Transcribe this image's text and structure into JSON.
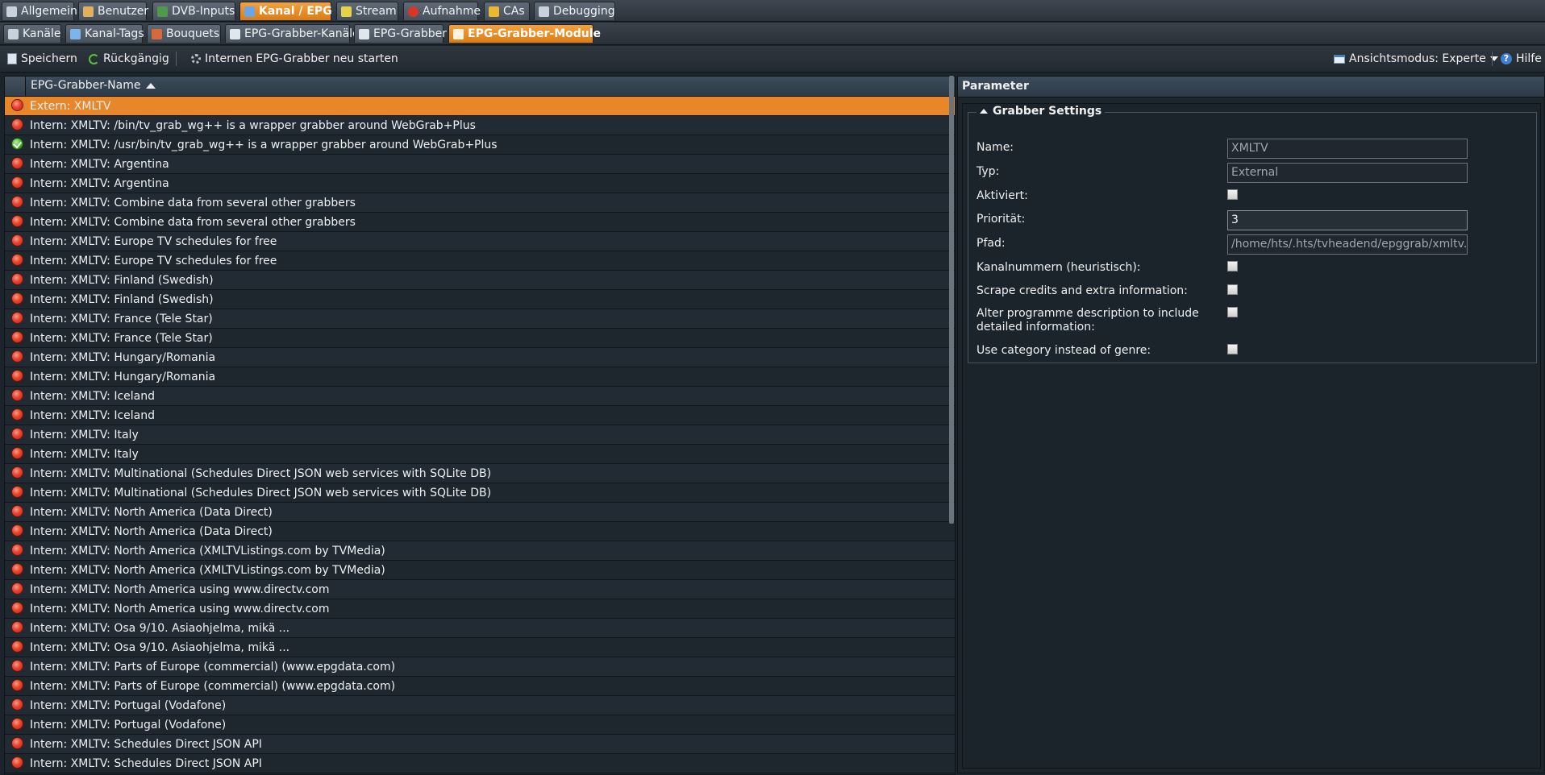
{
  "main_tabs": [
    {
      "label": "Allgemein",
      "icon": "wrench-icon",
      "color": "#c8d2dc"
    },
    {
      "label": "Benutzer",
      "icon": "users-icon",
      "color": "#e0b060"
    },
    {
      "label": "DVB-Inputs",
      "icon": "dvb-card-icon",
      "color": "#4f9a4a"
    },
    {
      "label": "Kanal / EPG",
      "icon": "tv-icon",
      "color": "#6aa6e6",
      "active": true
    },
    {
      "label": "Stream",
      "icon": "stream-icon",
      "color": "#e6d24a"
    },
    {
      "label": "Aufnahme",
      "icon": "record-icon",
      "color": "#d8362a"
    },
    {
      "label": "CAs",
      "icon": "key-icon",
      "color": "#e8b830"
    },
    {
      "label": "Debugging",
      "icon": "debug-icon",
      "color": "#c8d2dc"
    }
  ],
  "sub_tabs": [
    {
      "label": "Kanäle",
      "icon": "channels-icon",
      "color": "#c8d2dc"
    },
    {
      "label": "Kanal-Tags",
      "icon": "tags-icon",
      "color": "#7fb4e8"
    },
    {
      "label": "Bouquets",
      "icon": "bouquets-icon",
      "color": "#d86a3a"
    },
    {
      "label": "EPG-Grabber-Kanäle",
      "icon": "epg-channels-icon",
      "color": "#dfe6ee"
    },
    {
      "label": "EPG-Grabber",
      "icon": "epg-grabber-icon",
      "color": "#dfe6ee"
    },
    {
      "label": "EPG-Grabber-Module",
      "icon": "epg-modules-icon",
      "color": "#fff3dd",
      "active": true
    }
  ],
  "toolbar": {
    "save_label": "Speichern",
    "undo_label": "Rückgängig",
    "restart_label": "Internen EPG-Grabber neu starten",
    "view_mode_label": "Ansichtsmodus: Experte",
    "help_label": "Hilfe"
  },
  "grid": {
    "column_header": "EPG-Grabber-Name",
    "rows": [
      {
        "name": "Extern: XMLTV",
        "status": "red",
        "selected": true
      },
      {
        "name": "Intern: XMLTV: /bin/tv_grab_wg++ is a wrapper grabber around WebGrab+Plus",
        "status": "red"
      },
      {
        "name": "Intern: XMLTV: /usr/bin/tv_grab_wg++ is a wrapper grabber around WebGrab+Plus",
        "status": "green"
      },
      {
        "name": "Intern: XMLTV: Argentina",
        "status": "red"
      },
      {
        "name": "Intern: XMLTV: Argentina",
        "status": "red"
      },
      {
        "name": "Intern: XMLTV: Combine data from several other grabbers",
        "status": "red"
      },
      {
        "name": "Intern: XMLTV: Combine data from several other grabbers",
        "status": "red"
      },
      {
        "name": "Intern: XMLTV: Europe TV schedules for free",
        "status": "red"
      },
      {
        "name": "Intern: XMLTV: Europe TV schedules for free",
        "status": "red"
      },
      {
        "name": "Intern: XMLTV: Finland (Swedish)",
        "status": "red"
      },
      {
        "name": "Intern: XMLTV: Finland (Swedish)",
        "status": "red"
      },
      {
        "name": "Intern: XMLTV: France (Tele Star)",
        "status": "red"
      },
      {
        "name": "Intern: XMLTV: France (Tele Star)",
        "status": "red"
      },
      {
        "name": "Intern: XMLTV: Hungary/Romania",
        "status": "red"
      },
      {
        "name": "Intern: XMLTV: Hungary/Romania",
        "status": "red"
      },
      {
        "name": "Intern: XMLTV: Iceland",
        "status": "red"
      },
      {
        "name": "Intern: XMLTV: Iceland",
        "status": "red"
      },
      {
        "name": "Intern: XMLTV: Italy",
        "status": "red"
      },
      {
        "name": "Intern: XMLTV: Italy",
        "status": "red"
      },
      {
        "name": "Intern: XMLTV: Multinational (Schedules Direct JSON web services with SQLite DB)",
        "status": "red"
      },
      {
        "name": "Intern: XMLTV: Multinational (Schedules Direct JSON web services with SQLite DB)",
        "status": "red"
      },
      {
        "name": "Intern: XMLTV: North America (Data Direct)",
        "status": "red"
      },
      {
        "name": "Intern: XMLTV: North America (Data Direct)",
        "status": "red"
      },
      {
        "name": "Intern: XMLTV: North America (XMLTVListings.com by TVMedia)",
        "status": "red"
      },
      {
        "name": "Intern: XMLTV: North America (XMLTVListings.com by TVMedia)",
        "status": "red"
      },
      {
        "name": "Intern: XMLTV: North America using www.directv.com",
        "status": "red"
      },
      {
        "name": "Intern: XMLTV: North America using www.directv.com",
        "status": "red"
      },
      {
        "name": "Intern: XMLTV: Osa 9/10. Asiaohjelma, mikä ...",
        "status": "red"
      },
      {
        "name": "Intern: XMLTV: Osa 9/10. Asiaohjelma, mikä ...",
        "status": "red"
      },
      {
        "name": "Intern: XMLTV: Parts of Europe (commercial) (www.epgdata.com)",
        "status": "red"
      },
      {
        "name": "Intern: XMLTV: Parts of Europe (commercial) (www.epgdata.com)",
        "status": "red"
      },
      {
        "name": "Intern: XMLTV: Portugal (Vodafone)",
        "status": "red"
      },
      {
        "name": "Intern: XMLTV: Portugal (Vodafone)",
        "status": "red"
      },
      {
        "name": "Intern: XMLTV: Schedules Direct JSON API",
        "status": "red"
      },
      {
        "name": "Intern: XMLTV: Schedules Direct JSON API",
        "status": "red"
      }
    ]
  },
  "params": {
    "title": "Parameter",
    "section_title": "Grabber Settings",
    "name_label": "Name:",
    "name_value": "XMLTV",
    "type_label": "Typ:",
    "type_value": "External",
    "enabled_label": "Aktiviert:",
    "priority_label": "Priorität:",
    "priority_value": "3",
    "path_label": "Pfad:",
    "path_value": "/home/hts/.hts/tvheadend/epggrab/xmltv.sock",
    "channel_numbers_label": "Kanalnummern (heuristisch):",
    "scrape_label": "Scrape credits and extra information:",
    "alter_desc_label": "Alter programme description to include detailed information:",
    "category_label": "Use category instead of genre:"
  },
  "colors": {
    "accent": "#e8862a",
    "background": "#1b232b",
    "status_red": "#e8442c",
    "status_green": "#47b82d"
  }
}
